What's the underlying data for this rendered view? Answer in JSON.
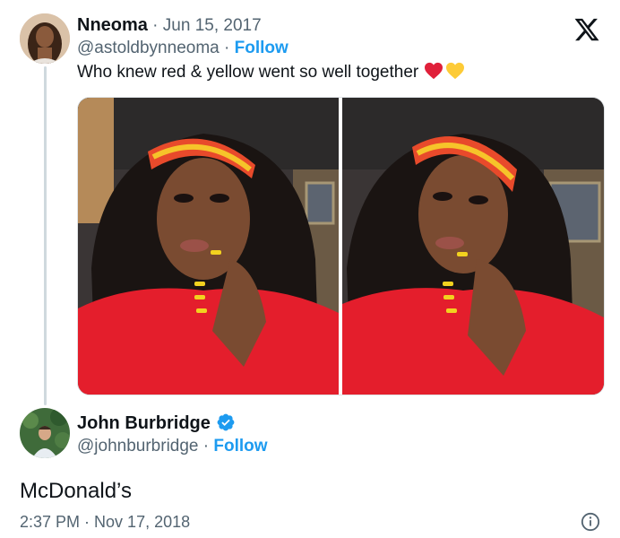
{
  "tweet": {
    "author_name": "Nneoma",
    "date_sep": " · ",
    "date": "Jun 15, 2017",
    "handle": "@astoldbynneoma",
    "follow_sep": " · ",
    "follow_label": "Follow",
    "text": "Who knew red & yellow went so well together",
    "emojis": [
      "red-heart-icon",
      "yellow-heart-icon"
    ]
  },
  "reply": {
    "author_name": "John Burbridge",
    "verified": true,
    "handle": "@johnburbridge",
    "follow_sep": " · ",
    "follow_label": "Follow",
    "text": "McDonald’s",
    "time": "2:37 PM",
    "time_sep": " · ",
    "date": "Nov 17, 2018"
  },
  "colors": {
    "text": "#0f1419",
    "muted": "#536471",
    "link": "#1d9bf0",
    "thread_line": "#cfd9de"
  }
}
